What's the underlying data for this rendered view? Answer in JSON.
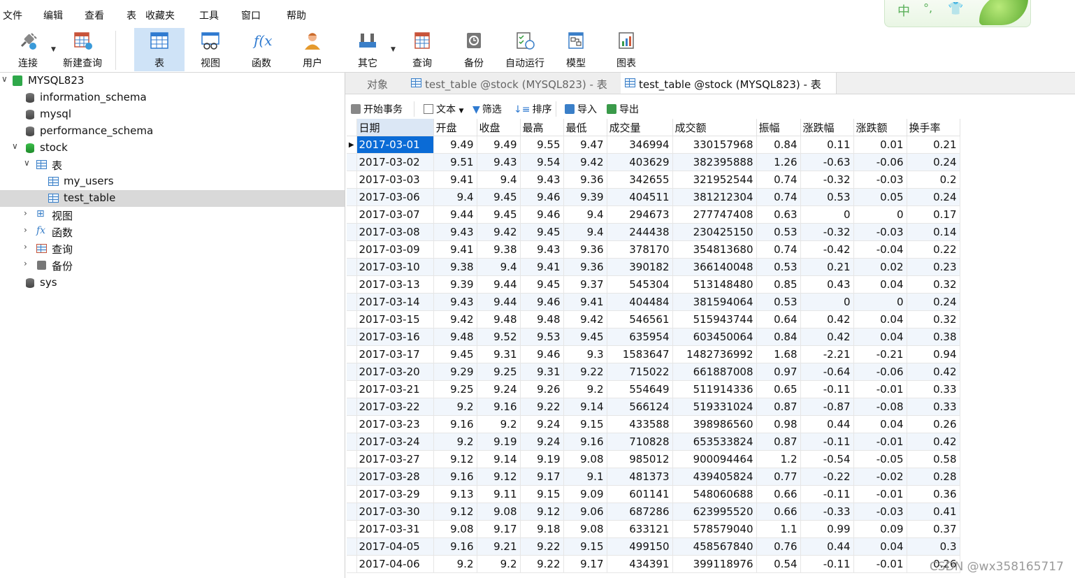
{
  "menu": [
    "文件",
    "编辑",
    "查看",
    "表",
    "收藏夹",
    "工具",
    "窗口",
    "帮助"
  ],
  "ime": {
    "mode": "中",
    "punct": "°,",
    "skin": "👕"
  },
  "toolbar": {
    "connect": "连接",
    "new_query": "新建查询",
    "table": "表",
    "view": "视图",
    "function": "函数",
    "user": "用户",
    "others": "其它",
    "query": "查询",
    "backup": "备份",
    "automation": "自动运行",
    "model": "模型",
    "chart": "图表"
  },
  "tree": {
    "connection": "MYSQL823",
    "databases": [
      "information_schema",
      "mysql",
      "performance_schema",
      "stock",
      "sys"
    ],
    "stock_children": {
      "tables_label": "表",
      "tables": [
        "my_users",
        "test_table"
      ],
      "views": "视图",
      "functions": "函数",
      "queries": "查询",
      "backups": "备份"
    }
  },
  "tabs": {
    "objects": "对象",
    "tab1": "test_table @stock (MYSQL823) - 表",
    "tab2": "test_table @stock (MYSQL823) - 表"
  },
  "actions": {
    "begin_transaction": "开始事务",
    "text": "文本",
    "filter": "筛选",
    "sort": "排序",
    "import": "导入",
    "export": "导出"
  },
  "grid": {
    "columns": [
      "日期",
      "开盘",
      "收盘",
      "最高",
      "最低",
      "成交量",
      "成交额",
      "振幅",
      "涨跌幅",
      "涨跌额",
      "换手率"
    ],
    "rows": [
      [
        "2017-03-01",
        "9.49",
        "9.49",
        "9.55",
        "9.47",
        "346994",
        "330157968",
        "0.84",
        "0.11",
        "0.01",
        "0.21"
      ],
      [
        "2017-03-02",
        "9.51",
        "9.43",
        "9.54",
        "9.42",
        "403629",
        "382395888",
        "1.26",
        "-0.63",
        "-0.06",
        "0.24"
      ],
      [
        "2017-03-03",
        "9.41",
        "9.4",
        "9.43",
        "9.36",
        "342655",
        "321952544",
        "0.74",
        "-0.32",
        "-0.03",
        "0.2"
      ],
      [
        "2017-03-06",
        "9.4",
        "9.45",
        "9.46",
        "9.39",
        "404511",
        "381212304",
        "0.74",
        "0.53",
        "0.05",
        "0.24"
      ],
      [
        "2017-03-07",
        "9.44",
        "9.45",
        "9.46",
        "9.4",
        "294673",
        "277747408",
        "0.63",
        "0",
        "0",
        "0.17"
      ],
      [
        "2017-03-08",
        "9.43",
        "9.42",
        "9.45",
        "9.4",
        "244438",
        "230425150",
        "0.53",
        "-0.32",
        "-0.03",
        "0.14"
      ],
      [
        "2017-03-09",
        "9.41",
        "9.38",
        "9.43",
        "9.36",
        "378170",
        "354813680",
        "0.74",
        "-0.42",
        "-0.04",
        "0.22"
      ],
      [
        "2017-03-10",
        "9.38",
        "9.4",
        "9.41",
        "9.36",
        "390182",
        "366140048",
        "0.53",
        "0.21",
        "0.02",
        "0.23"
      ],
      [
        "2017-03-13",
        "9.39",
        "9.44",
        "9.45",
        "9.37",
        "545304",
        "513148480",
        "0.85",
        "0.43",
        "0.04",
        "0.32"
      ],
      [
        "2017-03-14",
        "9.43",
        "9.44",
        "9.46",
        "9.41",
        "404484",
        "381594064",
        "0.53",
        "0",
        "0",
        "0.24"
      ],
      [
        "2017-03-15",
        "9.42",
        "9.48",
        "9.48",
        "9.42",
        "546561",
        "515943744",
        "0.64",
        "0.42",
        "0.04",
        "0.32"
      ],
      [
        "2017-03-16",
        "9.48",
        "9.52",
        "9.53",
        "9.45",
        "635954",
        "603450064",
        "0.84",
        "0.42",
        "0.04",
        "0.38"
      ],
      [
        "2017-03-17",
        "9.45",
        "9.31",
        "9.46",
        "9.3",
        "1583647",
        "1482736992",
        "1.68",
        "-2.21",
        "-0.21",
        "0.94"
      ],
      [
        "2017-03-20",
        "9.29",
        "9.25",
        "9.31",
        "9.22",
        "715022",
        "661887008",
        "0.97",
        "-0.64",
        "-0.06",
        "0.42"
      ],
      [
        "2017-03-21",
        "9.25",
        "9.24",
        "9.26",
        "9.2",
        "554649",
        "511914336",
        "0.65",
        "-0.11",
        "-0.01",
        "0.33"
      ],
      [
        "2017-03-22",
        "9.2",
        "9.16",
        "9.22",
        "9.14",
        "566124",
        "519331024",
        "0.87",
        "-0.87",
        "-0.08",
        "0.33"
      ],
      [
        "2017-03-23",
        "9.16",
        "9.2",
        "9.24",
        "9.15",
        "433588",
        "398986560",
        "0.98",
        "0.44",
        "0.04",
        "0.26"
      ],
      [
        "2017-03-24",
        "9.2",
        "9.19",
        "9.24",
        "9.16",
        "710828",
        "653533824",
        "0.87",
        "-0.11",
        "-0.01",
        "0.42"
      ],
      [
        "2017-03-27",
        "9.12",
        "9.14",
        "9.19",
        "9.08",
        "985012",
        "900094464",
        "1.2",
        "-0.54",
        "-0.05",
        "0.58"
      ],
      [
        "2017-03-28",
        "9.16",
        "9.12",
        "9.17",
        "9.1",
        "481373",
        "439405824",
        "0.77",
        "-0.22",
        "-0.02",
        "0.28"
      ],
      [
        "2017-03-29",
        "9.13",
        "9.11",
        "9.15",
        "9.09",
        "601141",
        "548060688",
        "0.66",
        "-0.11",
        "-0.01",
        "0.36"
      ],
      [
        "2017-03-30",
        "9.12",
        "9.08",
        "9.12",
        "9.06",
        "687286",
        "623995520",
        "0.66",
        "-0.33",
        "-0.03",
        "0.41"
      ],
      [
        "2017-03-31",
        "9.08",
        "9.17",
        "9.18",
        "9.08",
        "633121",
        "578579040",
        "1.1",
        "0.99",
        "0.09",
        "0.37"
      ],
      [
        "2017-04-05",
        "9.16",
        "9.21",
        "9.22",
        "9.15",
        "499150",
        "458567840",
        "0.76",
        "0.44",
        "0.04",
        "0.3"
      ],
      [
        "2017-04-06",
        "9.2",
        "9.2",
        "9.22",
        "9.17",
        "434391",
        "399118976",
        "0.54",
        "-0.11",
        "-0.01",
        "0.26"
      ]
    ]
  },
  "watermark": "CSDN @wx358165717"
}
